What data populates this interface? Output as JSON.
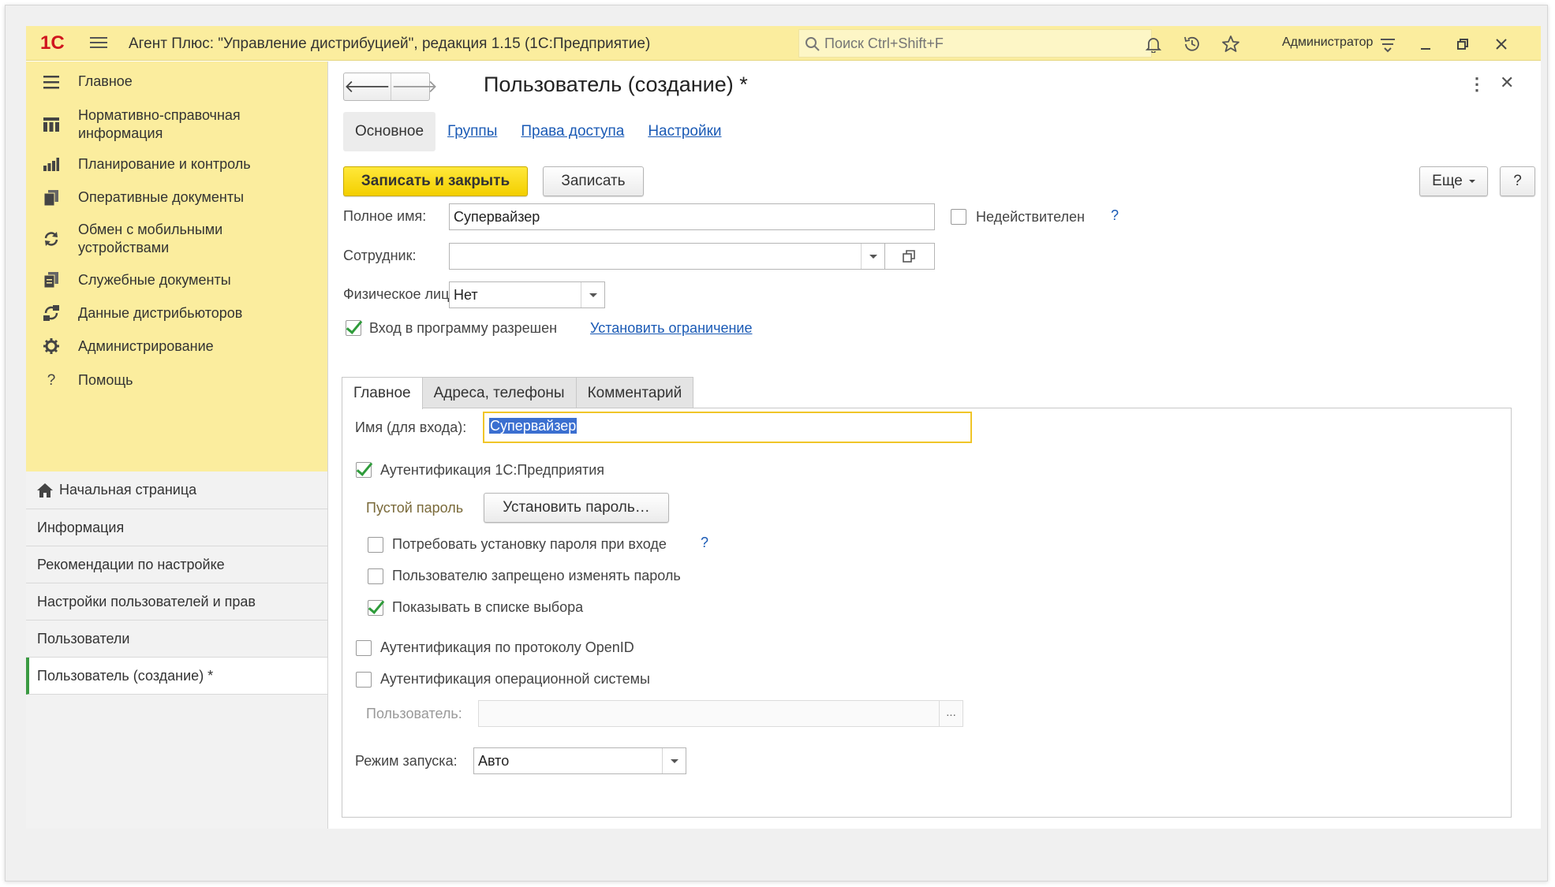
{
  "titlebar": {
    "logo": "1С",
    "app_title": "Агент Плюс: \"Управление дистрибуцией\", редакция 1.15  (1С:Предприятие)",
    "search_placeholder": "Поиск Ctrl+Shift+F",
    "user": "Администратор",
    "icons": [
      "menu-icon",
      "search-icon",
      "bell-icon",
      "history-icon",
      "star-icon",
      "settings-icon",
      "minimize-icon",
      "restore-icon",
      "close-icon"
    ]
  },
  "sidebar": {
    "sections": [
      {
        "label": "Главное",
        "icon": "menu-icon"
      },
      {
        "label": "Нормативно-справочная информация",
        "icon": "grid-icon"
      },
      {
        "label": "Планирование и контроль",
        "icon": "chart-icon"
      },
      {
        "label": "Оперативные документы",
        "icon": "documents-icon"
      },
      {
        "label": "Обмен с мобильными устройствами",
        "icon": "sync-icon"
      },
      {
        "label": "Служебные документы",
        "icon": "service-documents-icon"
      },
      {
        "label": "Данные дистрибьюторов",
        "icon": "distributor-icon"
      },
      {
        "label": "Администрирование",
        "icon": "gear-icon"
      },
      {
        "label": "Помощь",
        "icon": "help-icon"
      }
    ],
    "opened": [
      {
        "label": "Начальная страница"
      },
      {
        "label": "Информация"
      },
      {
        "label": "Рекомендации по настройке"
      },
      {
        "label": "Настройки пользователей и прав"
      },
      {
        "label": "Пользователи"
      },
      {
        "label": "Пользователь (создание) *"
      }
    ]
  },
  "form": {
    "title": "Пользователь (создание) *",
    "tabs": [
      "Основное",
      "Группы",
      "Права доступа",
      "Настройки"
    ],
    "toolbar": {
      "save_close": "Записать и закрыть",
      "save": "Записать",
      "more": "Еще",
      "help": "?"
    },
    "full_name_label": "Полное имя:",
    "full_name_value": "Супервайзер",
    "invalid_label": "Недействителен",
    "help_mark": "?",
    "employee_label": "Сотрудник:",
    "employee_value": "",
    "person_label": "Физическое лицо:",
    "person_value": "Нет",
    "login_allowed_label": "Вход в программу разрешен",
    "login_allowed_checked": true,
    "set_restriction_link": "Установить ограничение",
    "inner_tabs": [
      "Главное",
      "Адреса, телефоны",
      "Комментарий"
    ],
    "login_name_label": "Имя (для входа):",
    "login_name_value": "Супервайзер",
    "auth_1c_label": "Аутентификация 1С:Предприятия",
    "auth_1c_checked": true,
    "empty_password_label": "Пустой пароль",
    "set_password_button": "Установить пароль…",
    "require_password_label": "Потребовать установку пароля при входе",
    "require_password_checked": false,
    "forbid_change_label": "Пользователю запрещено изменять пароль",
    "forbid_change_checked": false,
    "show_in_list_label": "Показывать в списке выбора",
    "show_in_list_checked": true,
    "openid_label": "Аутентификация по протоколу OpenID",
    "openid_checked": false,
    "os_auth_label": "Аутентификация операционной системы",
    "os_auth_checked": false,
    "os_user_label": "Пользователь:",
    "os_user_value": "",
    "os_user_button": "...",
    "launch_mode_label": "Режим запуска:",
    "launch_mode_value": "Авто"
  },
  "colors": {
    "accent_yellow": "#fbed9e",
    "button_yellow": "#f3cf00",
    "link_blue": "#1a5ab5",
    "check_green": "#2e9b3a"
  }
}
